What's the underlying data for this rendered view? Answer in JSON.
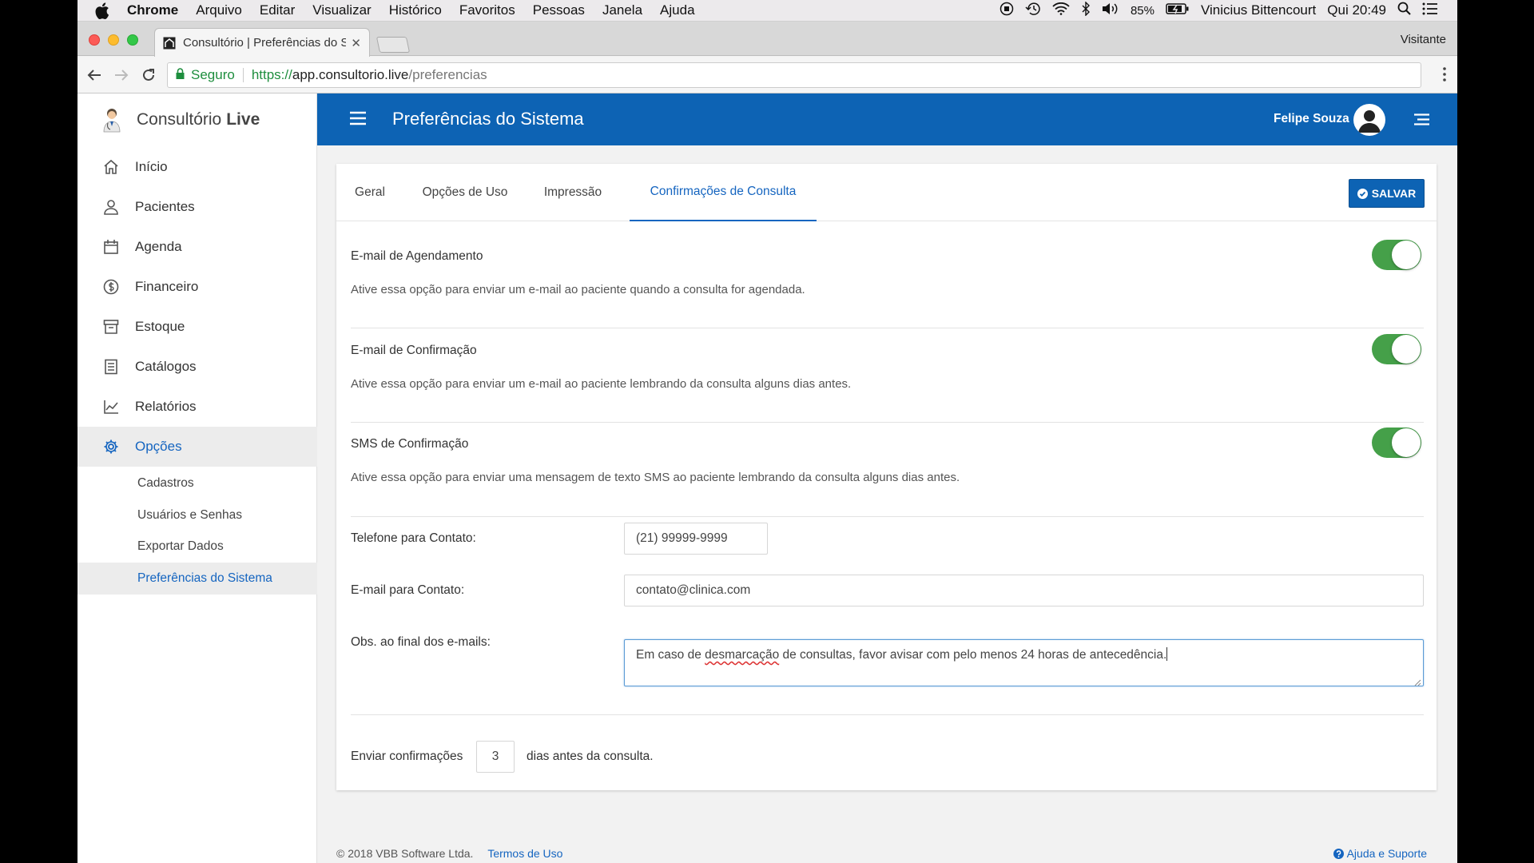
{
  "menubar": {
    "app": "Chrome",
    "items": [
      "Arquivo",
      "Editar",
      "Visualizar",
      "Histórico",
      "Favoritos",
      "Pessoas",
      "Janela",
      "Ajuda"
    ],
    "battery": "85%",
    "user": "Vinicius Bittencourt",
    "clock": "Qui 20:49"
  },
  "browser": {
    "tab_title": "Consultório | Preferências do S",
    "profile": "Visitante",
    "secure_label": "Seguro",
    "url_scheme": "https://",
    "url_host": "app.consultorio.live",
    "url_path": "/preferencias"
  },
  "brand": {
    "name": "Consultório",
    "name_bold": "Live"
  },
  "sidebar": {
    "items": [
      {
        "label": "Início",
        "icon": "home-icon"
      },
      {
        "label": "Pacientes",
        "icon": "user-icon"
      },
      {
        "label": "Agenda",
        "icon": "calendar-icon"
      },
      {
        "label": "Financeiro",
        "icon": "dollar-icon"
      },
      {
        "label": "Estoque",
        "icon": "archive-icon"
      },
      {
        "label": "Catálogos",
        "icon": "book-icon"
      },
      {
        "label": "Relatórios",
        "icon": "chart-icon"
      },
      {
        "label": "Opções",
        "icon": "gear-icon",
        "active": true
      }
    ],
    "subitems": [
      {
        "label": "Cadastros"
      },
      {
        "label": "Usuários e Senhas"
      },
      {
        "label": "Exportar Dados"
      },
      {
        "label": "Preferências do Sistema",
        "active": true
      }
    ]
  },
  "header": {
    "title": "Preferências do Sistema",
    "user": "Felipe Souza"
  },
  "tabs": [
    {
      "label": "Geral"
    },
    {
      "label": "Opções de Uso"
    },
    {
      "label": "Impressão"
    },
    {
      "label": "Confirmações de Consulta",
      "active": true
    }
  ],
  "save_label": "SALVAR",
  "options": [
    {
      "title": "E-mail de Agendamento",
      "desc": "Ative essa opção para enviar um e-mail ao paciente quando a consulta for agendada.",
      "enabled": true
    },
    {
      "title": "E-mail de Confirmação",
      "desc": "Ative essa opção para enviar um e-mail ao paciente lembrando da consulta alguns dias antes.",
      "enabled": true
    },
    {
      "title": "SMS de Confirmação",
      "desc": "Ative essa opção para enviar uma mensagem de texto SMS ao paciente lembrando da consulta alguns dias antes.",
      "enabled": true
    }
  ],
  "fields": {
    "phone_label": "Telefone para Contato:",
    "phone_value": "(21) 99999-9999",
    "email_label": "E-mail para Contato:",
    "email_value": "contato@clinica.com",
    "obs_label": "Obs. ao final dos e-mails:",
    "obs_before": "Em caso de ",
    "obs_misspelled": "desmarcação",
    "obs_after": " de consultas, favor avisar com pelo menos 24 horas de antecedência."
  },
  "send": {
    "prefix": "Enviar confirmações",
    "days": "3",
    "suffix": "dias antes da consulta."
  },
  "footer": {
    "copyright": "© 2018 VBB Software Ltda.",
    "terms": "Termos de Uso",
    "help": "Ajuda e Suporte"
  },
  "colors": {
    "header": "#0d63b4",
    "accent": "#1565c0",
    "toggle_on": "#45a049"
  }
}
